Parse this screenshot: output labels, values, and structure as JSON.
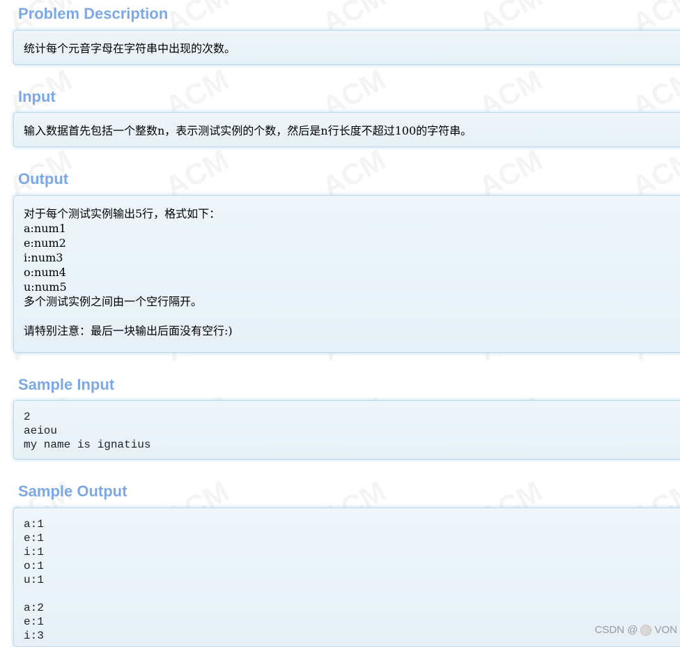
{
  "watermark_text": "ACM",
  "sections": {
    "problem_description": {
      "title": "Problem Description",
      "lines": [
        "统计每个元音字母在字符串中出现的次数。"
      ]
    },
    "input": {
      "title": "Input",
      "lines": [
        "输入数据首先包括一个整数n，表示测试实例的个数，然后是n行长度不超过100的字符串。"
      ]
    },
    "output": {
      "title": "Output",
      "lines": [
        "对于每个测试实例输出5行，格式如下：",
        "a:num1",
        "e:num2",
        "i:num3",
        "o:num4",
        "u:num5",
        "多个测试实例之间由一个空行隔开。",
        "",
        "请特别注意：最后一块输出后面没有空行:)"
      ]
    },
    "sample_input": {
      "title": "Sample Input",
      "lines": [
        "2",
        "aeiou",
        "my name is ignatius"
      ]
    },
    "sample_output": {
      "title": "Sample Output",
      "lines": [
        "a:1",
        "e:1",
        "i:1",
        "o:1",
        "u:1",
        "",
        "a:2",
        "e:1",
        "i:3"
      ]
    }
  },
  "footer": {
    "credit_prefix": "CSDN @",
    "credit_suffix": "VON"
  },
  "colors": {
    "title": "#7ca9e6",
    "panel_border": "#b9dcec",
    "panel_bg": "#eaf3f8"
  }
}
